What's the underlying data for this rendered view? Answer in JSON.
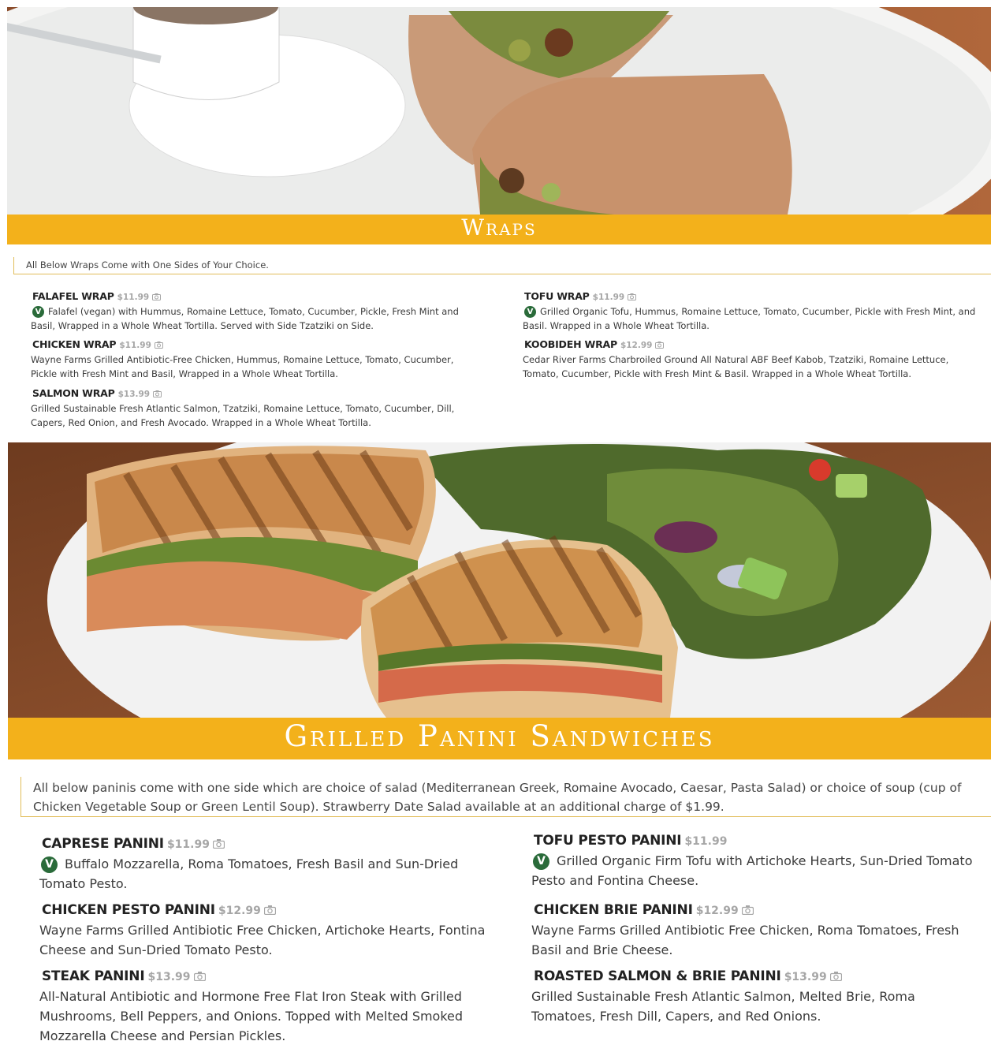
{
  "wraps": {
    "title": "Wraps",
    "intro": "All Below Wraps Come with One Sides of Your Choice.",
    "items": [
      {
        "name": "Falafel Wrap",
        "price": "$11.99",
        "vegan": true,
        "desc": "Falafel (vegan) with Hummus, Romaine Lettuce, Tomato, Cucumber, Pickle, Fresh Mint and Basil, Wrapped in a Whole Wheat Tortilla. Served with Side Tzatziki on Side."
      },
      {
        "name": "Chicken Wrap",
        "price": "$11.99",
        "desc": "Wayne Farms Grilled Antibiotic-Free Chicken, Hummus, Romaine Lettuce, Tomato, Cucumber, Pickle with Fresh Mint and Basil, Wrapped in a Whole Wheat Tortilla."
      },
      {
        "name": "Salmon Wrap",
        "price": "$13.99",
        "desc": "Grilled Sustainable Fresh Atlantic Salmon, Tzatziki, Romaine Lettuce, Tomato, Cucumber, Dill, Capers, Red Onion, and Fresh Avocado. Wrapped in a Whole Wheat Tortilla."
      },
      {
        "name": "Tofu Wrap",
        "price": "$11.99",
        "vegan": true,
        "desc": "Grilled Organic Tofu, Hummus, Romaine Lettuce, Tomato, Cucumber, Pickle with Fresh Mint, and Basil. Wrapped in a Whole Wheat Tortilla."
      },
      {
        "name": "Koobideh Wrap",
        "price": "$12.99",
        "desc": "Cedar River Farms Charbroiled Ground All Natural ABF Beef Kabob, Tzatziki, Romaine Lettuce, Tomato, Cucumber, Pickle with Fresh Mint & Basil. Wrapped in a Whole Wheat Tortilla."
      }
    ]
  },
  "panini": {
    "title": "Grilled Panini Sandwiches",
    "intro": "All below paninis come with one side which are choice of salad (Mediterranean Greek, Romaine Avocado, Caesar, Pasta Salad) or choice of soup (cup of Chicken Vegetable Soup or Green Lentil Soup). Strawberry Date Salad available at an additional charge of $1.99.",
    "items": [
      {
        "name": "Caprese Panini",
        "price": "$11.99",
        "vegan": true,
        "desc": "Buffalo Mozzarella, Roma Tomatoes, Fresh Basil and Sun-Dried Tomato Pesto."
      },
      {
        "name": "Chicken Pesto Panini",
        "price": "$12.99",
        "desc": "Wayne Farms Grilled Antibiotic Free Chicken, Artichoke Hearts, Fontina Cheese and Sun-Dried Tomato Pesto."
      },
      {
        "name": "Steak Panini",
        "price": "$13.99",
        "desc": "All-Natural Antibiotic and Hormone Free Flat Iron Steak with Grilled Mushrooms, Bell Peppers, and Onions. Topped with Melted Smoked Mozzarella Cheese and Persian Pickles."
      },
      {
        "name": "Tofu Pesto Panini",
        "price": "$11.99",
        "vegan": true,
        "desc": "Grilled Organic Firm Tofu with Artichoke Hearts, Sun-Dried Tomato Pesto and Fontina Cheese."
      },
      {
        "name": "Chicken Brie Panini",
        "price": "$12.99",
        "desc": "Wayne Farms Grilled Antibiotic Free Chicken, Roma Tomatoes, Fresh Basil and Brie Cheese."
      },
      {
        "name": "Roasted Salmon & Brie Panini",
        "price": "$13.99",
        "desc": "Grilled Sustainable Fresh Atlantic Salmon, Melted Brie, Roma Tomatoes, Fresh Dill, Capers, and Red Onions."
      }
    ]
  },
  "vegan_badge": "V",
  "icons": {
    "camera": "camera-icon",
    "vegan": "vegan-badge-icon"
  },
  "colors": {
    "banner": "#f3b11b",
    "vegan": "#2a6b3a",
    "price": "#a6a6a6"
  }
}
